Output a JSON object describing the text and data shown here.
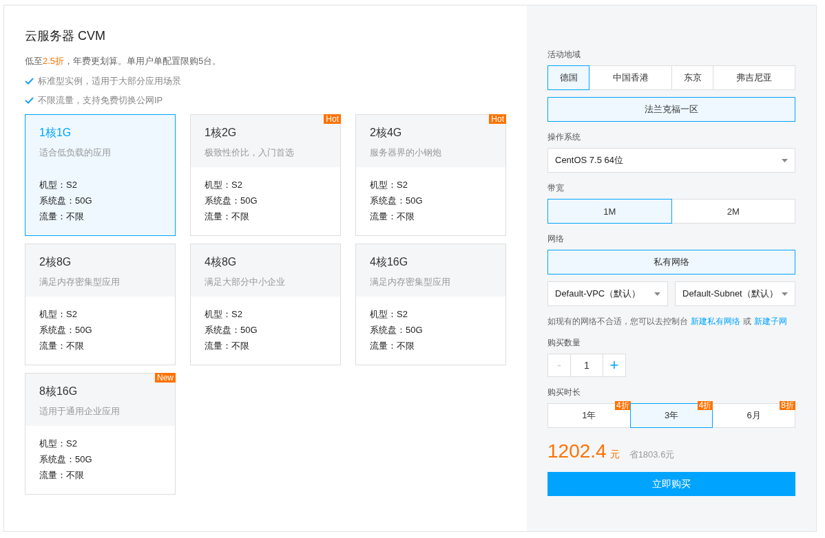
{
  "product": {
    "title": "云服务器 CVM",
    "promo": "低至**2.5折**，年费更划算。单用户单配置限购5台。",
    "features": [
      "标准型实例，适用于大部分应用场景",
      "不限流量，支持免费切换公网IP"
    ]
  },
  "plans": [
    {
      "name": "1核1G",
      "desc": "适合低负载的应用",
      "selected": true,
      "specs": [
        "机型：S2",
        "系统盘：50G",
        "流量：不限"
      ]
    },
    {
      "name": "1核2G",
      "desc": "极致性价比，入门首选",
      "badge": "Hot",
      "selected": false,
      "specs": [
        "机型：S2",
        "系统盘：50G",
        "流量：不限"
      ]
    },
    {
      "name": "2核4G",
      "desc": "服务器界的小钢炮",
      "badge": "Hot",
      "selected": false,
      "specs": [
        "机型：S2",
        "系统盘：50G",
        "流量：不限"
      ]
    },
    {
      "name": "2核8G",
      "desc": "满足内存密集型应用",
      "selected": false,
      "specs": [
        "机型：S2",
        "系统盘：50G",
        "流量：不限"
      ]
    },
    {
      "name": "4核8G",
      "desc": "满足大部分中小企业",
      "selected": false,
      "specs": [
        "机型：S2",
        "系统盘：50G",
        "流量：不限"
      ]
    },
    {
      "name": "4核16G",
      "desc": "满足内存密集型应用",
      "selected": false,
      "specs": [
        "机型：S2",
        "系统盘：50G",
        "流量：不限"
      ]
    },
    {
      "name": "8核16G",
      "desc": "适用于通用企业应用",
      "badge": "New",
      "selected": false,
      "specs": [
        "机型：S2",
        "系统盘：50G",
        "流量：不限"
      ]
    }
  ],
  "config": {
    "region": {
      "label": "活动地域",
      "options": [
        {
          "label": "德国",
          "selected": true
        },
        {
          "label": "中国香港",
          "selected": false
        },
        {
          "label": "东京",
          "selected": false
        },
        {
          "label": "弗吉尼亚",
          "selected": false
        }
      ],
      "zones": [
        {
          "label": "法兰克福一区",
          "selected": true
        }
      ]
    },
    "os": {
      "label": "操作系统",
      "value": "CentOS 7.5 64位"
    },
    "bandwidth": {
      "label": "带宽",
      "options": [
        {
          "label": "1M",
          "selected": true
        },
        {
          "label": "2M",
          "selected": false
        }
      ]
    },
    "network": {
      "label": "网络",
      "options": [
        {
          "label": "私有网络",
          "selected": true
        }
      ],
      "vpc": "Default-VPC（默认）",
      "subnet": "Default-Subnet（默认）",
      "hint": "如现有的网络不合适，您可以去控制台",
      "link1": "新建私有网络",
      "or": "或",
      "link2": "新建子网"
    },
    "quantity": {
      "label": "购买数量",
      "minus": "-",
      "value": "1",
      "plus": "+",
      "minus_disabled": true
    },
    "duration": {
      "label": "购买时长",
      "options": [
        {
          "label": "1年",
          "discount": "4折",
          "selected": false
        },
        {
          "label": "3年",
          "discount": "4折",
          "selected": true
        },
        {
          "label": "6月",
          "discount": "8折",
          "selected": false
        }
      ]
    },
    "price": {
      "amount": "1202.4",
      "unit": "元",
      "saving": "省1803.6元"
    },
    "buy_button": "立即购买"
  }
}
